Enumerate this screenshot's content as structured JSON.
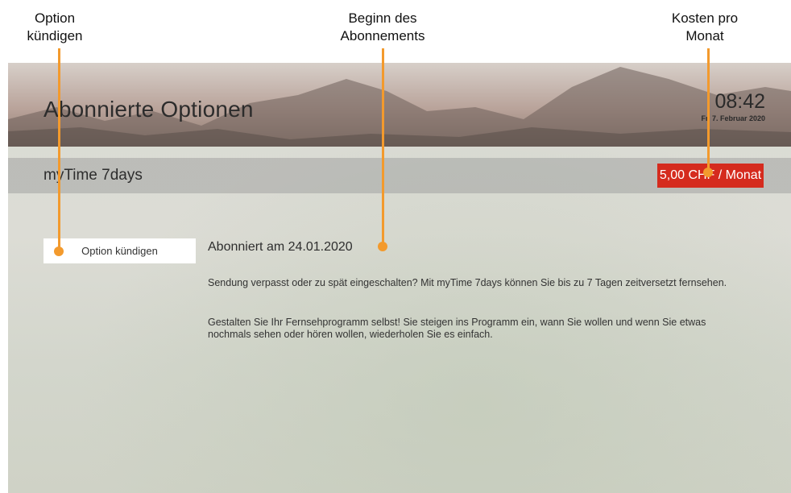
{
  "annotations": {
    "cancel_option": "Option\nkündigen",
    "subscription_start": "Beginn des\nAbonnements",
    "monthly_cost": "Kosten pro\nMonat"
  },
  "header": {
    "title": "Abonnierte Optionen",
    "time": "08:42",
    "date": "Fr, 7. Februar 2020"
  },
  "subscription": {
    "name": "myTime 7days",
    "price": "5,00 CHF / Monat",
    "cancel_button": "Option kündigen",
    "subscribed_on": "Abonniert am 24.01.2020",
    "description_1": "Sendung verpasst oder zu spät eingeschalten? Mit myTime 7days können Sie bis zu 7 Tagen zeitversetzt fernsehen.",
    "description_2": "Gestalten Sie Ihr Fernsehprogramm selbst! Sie steigen ins Programm ein, wann Sie wollen und wenn Sie etwas nochmals sehen oder hören wollen, wiederholen Sie es einfach."
  },
  "colors": {
    "accent": "#d52b1e",
    "annotation": "#f39a2d"
  }
}
